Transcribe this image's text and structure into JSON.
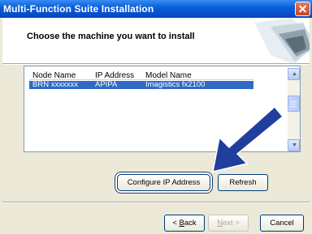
{
  "window": {
    "title": "Multi-Function Suite Installation"
  },
  "header": {
    "instruction": "Choose the machine you want to install"
  },
  "list": {
    "columns": [
      "Node Name",
      "IP Address",
      "Model Name"
    ],
    "rows": [
      {
        "node_name": "BRN xxxxxxx",
        "ip_address": "APIPA",
        "model_name": "Imagistics fx2100",
        "selected": true
      }
    ]
  },
  "buttons": {
    "configure_ip": "Configure IP Address",
    "refresh": "Refresh",
    "back": "Back",
    "back_prefix": "< ",
    "back_accel": "B",
    "back_rest": "ack",
    "next": "Next >",
    "next_accel": "N",
    "next_rest": "ext >",
    "cancel": "Cancel"
  },
  "colors": {
    "title_bar": "#0a5fd9",
    "selection": "#316ac5",
    "arrow": "#1f3e9e",
    "dialog_bg": "#ece9d8"
  },
  "icons": {
    "close": "close-icon",
    "arrow": "pointer-arrow-icon",
    "header": "wizard-graphic-icon"
  }
}
